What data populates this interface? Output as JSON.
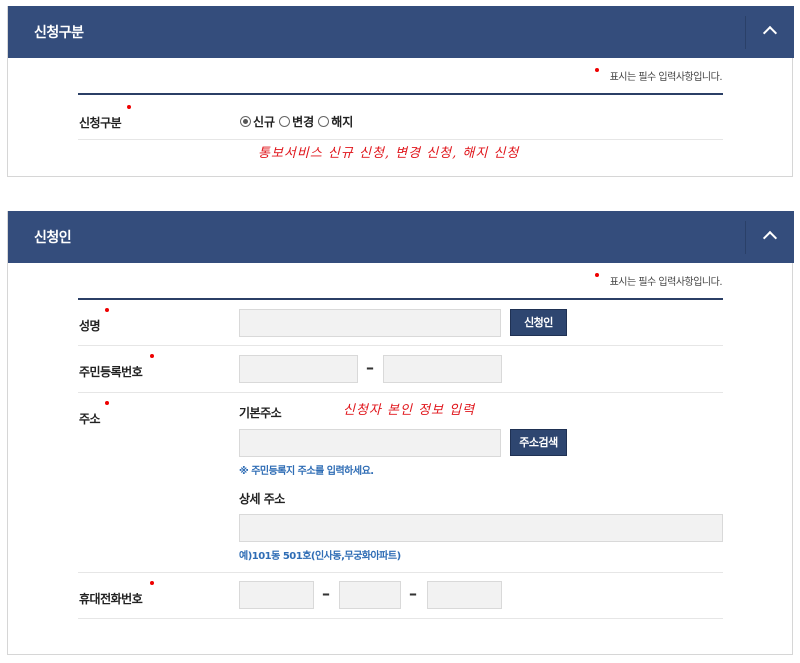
{
  "application_type_section": {
    "title": "신청구분",
    "required_note": "표시는 필수 입력사항입니다.",
    "field_label": "신청구분",
    "radios": [
      {
        "label": "신규",
        "checked": true
      },
      {
        "label": "변경",
        "checked": false
      },
      {
        "label": "해지",
        "checked": false
      }
    ],
    "annotation": "통보서비스 신규 신청, 변경 신청, 해지 신청"
  },
  "applicant_section": {
    "title": "신청인",
    "required_note": "표시는 필수 입력사항입니다.",
    "name": {
      "label": "성명",
      "value": "",
      "button": "신청인"
    },
    "resident_number": {
      "label": "주민등록번호",
      "dash": "–"
    },
    "address": {
      "label": "주소",
      "basic_label": "기본주소",
      "search_button": "주소검색",
      "basic_hint": "※ 주민등록지 주소를 입력하세요.",
      "detail_label": "상세 주소",
      "detail_hint": "예)101동 501호(인사동,무궁화아파트)"
    },
    "phone": {
      "label": "휴대전화번호",
      "dash": "–"
    },
    "annotation": "신청자 본인 정보 입력"
  },
  "colors": {
    "header_bg": "#344d7c",
    "required_dot": "#e00000",
    "hint_text": "#2f6db5",
    "annotation": "#e0151b"
  }
}
